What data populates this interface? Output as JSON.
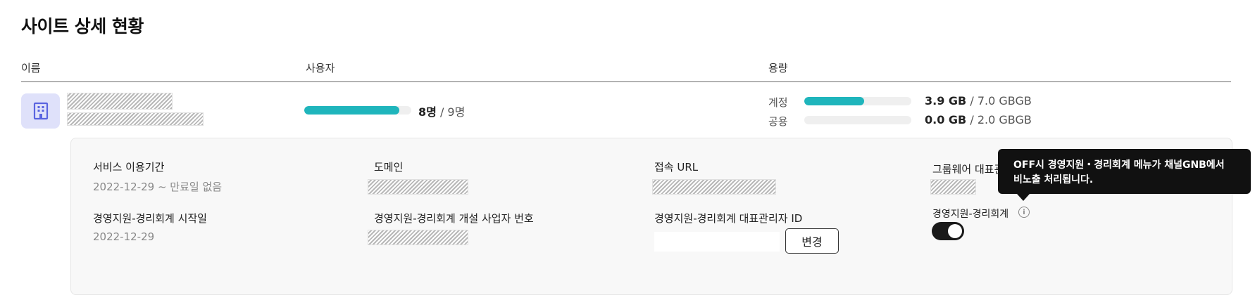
{
  "page": {
    "title": "사이트 상세 현황"
  },
  "columns": {
    "name": "이름",
    "users": "사용자",
    "capacity": "용량"
  },
  "site": {
    "icon": "building-icon",
    "users": {
      "used": "8명",
      "separator": " / ",
      "total": "9명",
      "ratio": 0.889
    },
    "capacity": {
      "account": {
        "label": "계정",
        "used": "3.9 GB",
        "separator": " / ",
        "total": "7.0 GBGB",
        "ratio": 0.557
      },
      "shared": {
        "label": "공용",
        "used": "0.0 GB",
        "separator": " / ",
        "total": "2.0 GBGB",
        "ratio": 0.0
      }
    }
  },
  "details": {
    "service_period": {
      "label": "서비스 이용기간",
      "value": "2022-12-29 ~ 만료일 없음"
    },
    "domain": {
      "label": "도메인"
    },
    "access_url": {
      "label": "접속 URL"
    },
    "groupware_admin": {
      "label": "그룹웨어 대표관"
    },
    "erp_start": {
      "label": "경영지원-경리회계 시작일",
      "value": "2022-12-29"
    },
    "erp_business_number": {
      "label": "경영지원-경리회계 개설 사업자 번호"
    },
    "erp_admin_id": {
      "label": "경영지원-경리회계 대표관리자 ID",
      "value": "",
      "button": "변경"
    },
    "erp_toggle": {
      "label": "경영지원-경리회계",
      "state": "on"
    }
  },
  "tooltip": {
    "line1": "OFF시 경영지원・경리회계 메뉴가 채널GNB에서",
    "line2": "비노출 처리됩니다."
  },
  "colors": {
    "accent": "#1fb5bc",
    "icon_bg": "#dfe1fa",
    "icon_fg": "#5a64e0",
    "toggle_on": "#1a1a1a"
  }
}
